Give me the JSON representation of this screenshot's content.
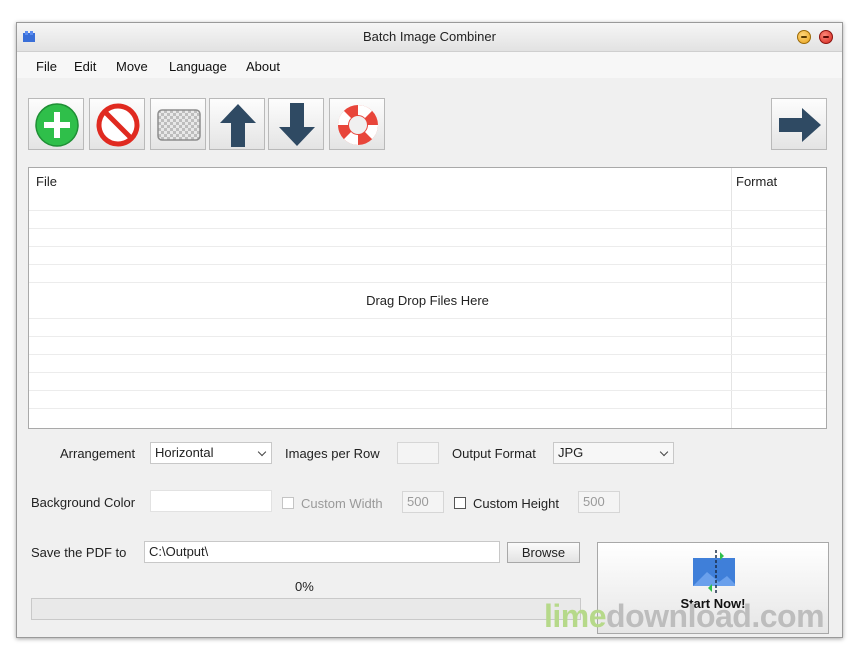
{
  "window": {
    "title": "Batch Image Combiner"
  },
  "menu": [
    {
      "label": "File"
    },
    {
      "label": "Edit"
    },
    {
      "label": "Move"
    },
    {
      "label": "Language"
    },
    {
      "label": "About"
    }
  ],
  "toolbar": {
    "buttons": [
      {
        "icon": "add-icon"
      },
      {
        "icon": "remove-icon"
      },
      {
        "icon": "clear-icon"
      },
      {
        "icon": "move-up-icon"
      },
      {
        "icon": "move-down-icon"
      },
      {
        "icon": "help-icon"
      },
      {
        "icon": "next-arrow-icon"
      }
    ]
  },
  "filelist": {
    "columns": [
      "File",
      "Format"
    ],
    "empty_text": "Drag  Drop Files Here"
  },
  "options": {
    "arrangement_label": "Arrangement",
    "arrangement_value": "Horizontal",
    "images_per_row_label": "Images per Row",
    "images_per_row_value": "",
    "output_format_label": "Output Format",
    "output_format_value": "JPG",
    "background_color_label": "Background Color",
    "background_color_value": "",
    "custom_width_label": "Custom Width",
    "custom_width_value": "500",
    "custom_width_checked": false,
    "custom_height_label": "Custom Height",
    "custom_height_value": "500",
    "custom_height_checked": false
  },
  "save": {
    "label": "Save the PDF to",
    "path": "C:\\Output\\",
    "browse_label": "Browse"
  },
  "progress": {
    "text": "0%",
    "value": 0
  },
  "start": {
    "label": "Start Now!"
  },
  "watermark": {
    "part1": "lime",
    "part2": "download.com"
  },
  "colors": {
    "accent_green": "#2fbf4a",
    "stop_red": "#e02a20",
    "arrow_navy": "#2f4a63",
    "watermark_green": "#b6d98a"
  }
}
